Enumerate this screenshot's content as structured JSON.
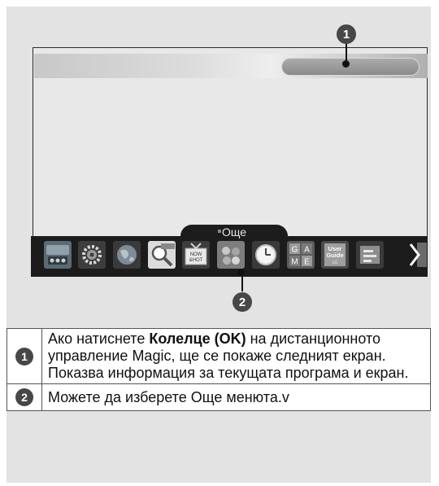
{
  "callouts": {
    "one": "1",
    "two": "2"
  },
  "menu": {
    "more_label": "Още",
    "icons": [
      "media-player-icon",
      "settings-gear-icon",
      "globe-icon",
      "search-icon",
      "now-hot-icon",
      "apps-icon",
      "clock-icon",
      "game-icon",
      "user-guide-icon",
      "notes-icon"
    ],
    "now_hot_text": "NOW &HOT",
    "game_letters": [
      "G",
      "A",
      "M",
      "E"
    ],
    "user_guide_text": "User Guide",
    "user_guide_brand": "LG",
    "search_tag": "Search",
    "scroll_arrow_icon": "chevron-right-icon"
  },
  "legend": {
    "rows": [
      {
        "num": "1",
        "text_before": "Ако натиснете ",
        "text_bold": "Колелце (OK)",
        "text_after": " на дистанционното управление Magic, ще се покаже следният екран.",
        "text_line2": "Показва информация за текущата програма и екран."
      },
      {
        "num": "2",
        "text": "Можете да изберете Още менюта.v"
      }
    ]
  },
  "colors": {
    "badge": "#474747",
    "menubar": "#1c1c1c",
    "panel": "#e3e3e3"
  }
}
